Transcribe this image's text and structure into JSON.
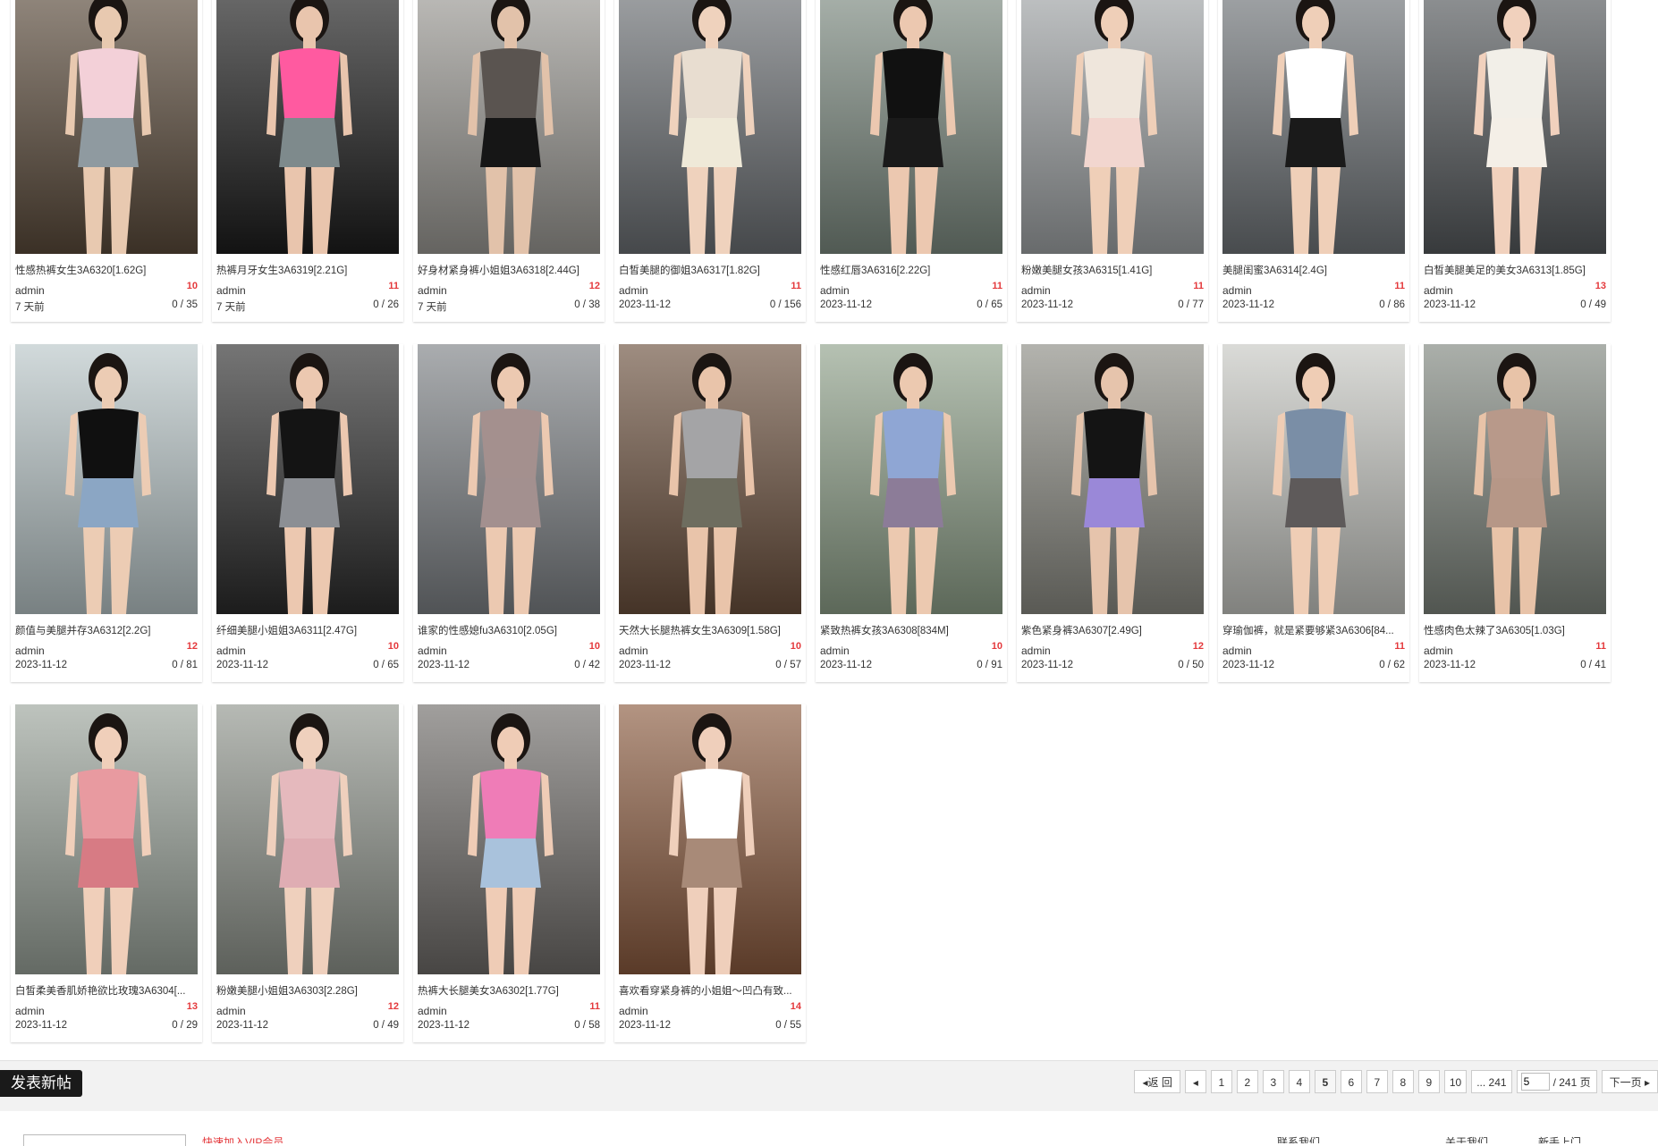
{
  "posts": [
    {
      "title": "性感热裤女生3A6320[1.62G]",
      "author": "admin",
      "replies": "10",
      "date": "7 天前",
      "views": "0 / 35",
      "palette": [
        "#5a4a3a",
        "#f3d0d8",
        "#8f9aa0",
        "#e8c9b0"
      ]
    },
    {
      "title": "热裤月牙女生3A6319[2.21G]",
      "author": "admin",
      "replies": "11",
      "date": "7 天前",
      "views": "0 / 26",
      "palette": [
        "#1c1c1c",
        "#ff5aa0",
        "#7e8a8c",
        "#e9c5ad"
      ]
    },
    {
      "title": "好身材紧身裤小姐姐3A6318[2.44G]",
      "author": "admin",
      "replies": "12",
      "date": "7 天前",
      "views": "0 / 38",
      "palette": [
        "#9b9994",
        "#5a5450",
        "#161616",
        "#e2c2aa"
      ]
    },
    {
      "title": "白皙美腿的御姐3A6317[1.82G]",
      "author": "admin",
      "replies": "11",
      "date": "2023-11-12",
      "views": "0 / 156",
      "palette": [
        "#6b6f73",
        "#e8ddd0",
        "#efe9d8",
        "#efd2bd"
      ]
    },
    {
      "title": "性感红唇3A6316[2.22G]",
      "author": "admin",
      "replies": "11",
      "date": "2023-11-12",
      "views": "0 / 65",
      "palette": [
        "#7c8a80",
        "#111111",
        "#1a1a1a",
        "#ecc8b0"
      ]
    },
    {
      "title": "粉嫩美腿女孩3A6315[1.41G]",
      "author": "admin",
      "replies": "11",
      "date": "2023-11-12",
      "views": "0 / 77",
      "palette": [
        "#a0a4a6",
        "#efe6dc",
        "#f2d6cf",
        "#efcfb8"
      ]
    },
    {
      "title": "美腿闺蜜3A6314[2.4G]",
      "author": "admin",
      "replies": "11",
      "date": "2023-11-12",
      "views": "0 / 86",
      "palette": [
        "#6f7478",
        "#ffffff",
        "#1a1a1a",
        "#efcfb8"
      ]
    },
    {
      "title": "白皙美腿美足的美女3A6313[1.85G]",
      "author": "admin",
      "replies": "13",
      "date": "2023-11-12",
      "views": "0 / 49",
      "palette": [
        "#55595c",
        "#f2efe8",
        "#f4efe7",
        "#f1d1bd"
      ]
    },
    {
      "title": "颜值与美腿并存3A6312[2.2G]",
      "author": "admin",
      "replies": "12",
      "date": "2023-11-12",
      "views": "0 / 81",
      "palette": [
        "#b9c6c8",
        "#101010",
        "#8ba6c4",
        "#ecccb4"
      ]
    },
    {
      "title": "纤细美腿小姐姐3A6311[2.47G]",
      "author": "admin",
      "replies": "10",
      "date": "2023-11-12",
      "views": "0 / 65",
      "palette": [
        "#2b2b2b",
        "#141414",
        "#8c8f94",
        "#ecc8b0"
      ]
    },
    {
      "title": "谁家的性感媳fu3A6310[2.05G]",
      "author": "admin",
      "replies": "10",
      "date": "2023-11-12",
      "views": "0 / 42",
      "palette": [
        "#7c8084",
        "#a4908e",
        "#a3908f",
        "#ecc9b1"
      ]
    },
    {
      "title": "天然大长腿热裤女生3A6309[1.58G]",
      "author": "admin",
      "replies": "10",
      "date": "2023-11-12",
      "views": "0 / 57",
      "palette": [
        "#6a4f3c",
        "#a4a4a6",
        "#6e6d5f",
        "#e9c4aa"
      ]
    },
    {
      "title": "紧致热裤女孩3A6308[834M]",
      "author": "admin",
      "replies": "10",
      "date": "2023-11-12",
      "views": "0 / 91",
      "palette": [
        "#8ea089",
        "#8fa6d4",
        "#8c7c98",
        "#ecc9b0"
      ]
    },
    {
      "title": "紫色紧身裤3A6307[2.49G]",
      "author": "admin",
      "replies": "12",
      "date": "2023-11-12",
      "views": "0 / 50",
      "palette": [
        "#8a8a82",
        "#141414",
        "#9a88d8",
        "#e6c4ac"
      ]
    },
    {
      "title": "穿瑜伽裤，就是紧要够紧3A6306[84...",
      "author": "admin",
      "replies": "11",
      "date": "2023-11-12",
      "views": "0 / 62",
      "palette": [
        "#c6c7c2",
        "#7a8ea6",
        "#5e5a5a",
        "#efcdb5"
      ]
    },
    {
      "title": "性感肉色太辣了3A6305[1.03G]",
      "author": "admin",
      "replies": "11",
      "date": "2023-11-12",
      "views": "0 / 41",
      "palette": [
        "#7d847c",
        "#b8998a",
        "#b69787",
        "#e8c3a8"
      ]
    },
    {
      "title": "白皙柔美香肌娇艳欲比玫瑰3A6304[...",
      "author": "admin",
      "replies": "13",
      "date": "2023-11-12",
      "views": "0 / 29",
      "palette": [
        "#9aa39a",
        "#e89aa0",
        "#d77b84",
        "#f0cfba"
      ]
    },
    {
      "title": "粉嫩美腿小姐姐3A6303[2.28G]",
      "author": "admin",
      "replies": "12",
      "date": "2023-11-12",
      "views": "0 / 49",
      "palette": [
        "#8f948c",
        "#e5b9bd",
        "#dfadb3",
        "#efd0bd"
      ]
    },
    {
      "title": "热裤大长腿美女3A6302[1.77G]",
      "author": "admin",
      "replies": "11",
      "date": "2023-11-12",
      "views": "0 / 58",
      "palette": [
        "#6e6b68",
        "#ef7cb7",
        "#a9c2dc",
        "#efccb6"
      ]
    },
    {
      "title": "喜欢看穿紧身裤的小姐姐～凹凸有致...",
      "author": "admin",
      "replies": "14",
      "date": "2023-11-12",
      "views": "0 / 55",
      "palette": [
        "#8a5a3e",
        "#ffffff",
        "#a88a78",
        "#efcfbb"
      ]
    }
  ],
  "new_post_label": "发表新帖",
  "pager": {
    "back": "返 回",
    "pages": [
      "1",
      "2",
      "3",
      "4",
      "5",
      "6",
      "7",
      "8",
      "9",
      "10",
      "... 241"
    ],
    "current": "5",
    "input_value": "5",
    "total": "/ 241 页",
    "next": "下一页"
  },
  "footer": {
    "link1": "快速加入VIP会员",
    "link2": "联系我们",
    "link3": "关于我们",
    "link4": "新手上门"
  },
  "colors": {
    "accent_red": "#e4393c",
    "button_dark": "#1a1a1a"
  }
}
